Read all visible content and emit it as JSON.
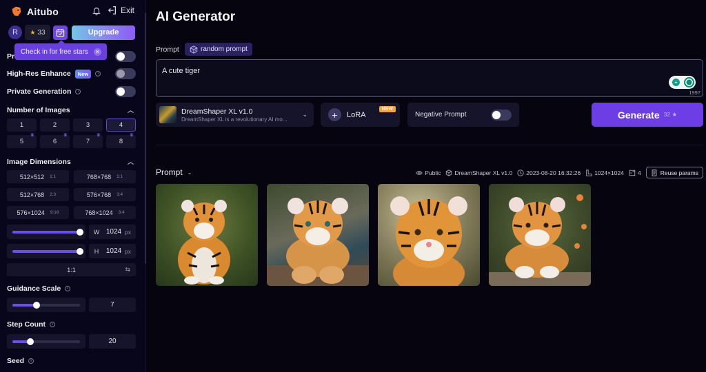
{
  "sidebar": {
    "brand": "Aitubo",
    "exit_label": "Exit",
    "user_initial": "R",
    "stars_count": "33",
    "upgrade_label": "Upgrade",
    "tooltip": "Check in for free stars",
    "toggles": [
      {
        "label": "Pr",
        "badge": "",
        "state": "on"
      },
      {
        "label": "High-Res Enhance",
        "badge": "New",
        "state": "off"
      },
      {
        "label": "Private Generation",
        "badge": "",
        "state": "on"
      }
    ],
    "number_of_images": {
      "title": "Number of Images",
      "options": [
        "1",
        "2",
        "3",
        "4",
        "5",
        "6",
        "7",
        "8"
      ],
      "selected": "4"
    },
    "image_dimensions": {
      "title": "Image Dimensions",
      "presets": [
        {
          "size": "512×512",
          "ratio": "1:1"
        },
        {
          "size": "768×768",
          "ratio": "1:1"
        },
        {
          "size": "512×768",
          "ratio": "2:3"
        },
        {
          "size": "576×768",
          "ratio": "3:4"
        },
        {
          "size": "576×1024",
          "ratio": "9:16"
        },
        {
          "size": "768×1024",
          "ratio": "3:4"
        }
      ],
      "width": {
        "key": "W",
        "value": "1024",
        "unit": "px",
        "fraction": 1.0
      },
      "height": {
        "key": "H",
        "value": "1024",
        "unit": "px",
        "fraction": 1.0
      },
      "aspect_ratio": "1:1"
    },
    "guidance_scale": {
      "title": "Guidance Scale",
      "value": "7",
      "fraction": 0.36
    },
    "step_count": {
      "title": "Step Count",
      "value": "20",
      "fraction": 0.27
    },
    "seed": {
      "title": "Seed"
    }
  },
  "main": {
    "title": "AI Generator",
    "prompt_label": "Prompt",
    "random_prompt_label": "random prompt",
    "prompt_value": "A cute tiger",
    "char_count": "1997",
    "model": {
      "name": "DreamShaper XL v1.0",
      "description": "DreamShaper XL is a revolutionary AI mo..."
    },
    "lora_label": "LoRA",
    "lora_badge": "NEW",
    "negative_prompt_label": "Negative Prompt",
    "generate_label": "Generate",
    "generate_cost": "32",
    "result": {
      "title": "Prompt",
      "visibility": "Public",
      "model": "DreamShaper XL v1.0",
      "timestamp": "2023-08-20 16:32:26",
      "dimensions": "1024×1024",
      "count": "4",
      "reuse_label": "Reuse params",
      "images": [
        "tiger cub sitting in jungle",
        "tiger cub lying on log",
        "tiger cub close-up portrait",
        "tiger cub on rock with flowers"
      ]
    }
  },
  "colors": {
    "accent": "#6d3ee6",
    "background": "#05040f",
    "panel": "#15142a"
  }
}
